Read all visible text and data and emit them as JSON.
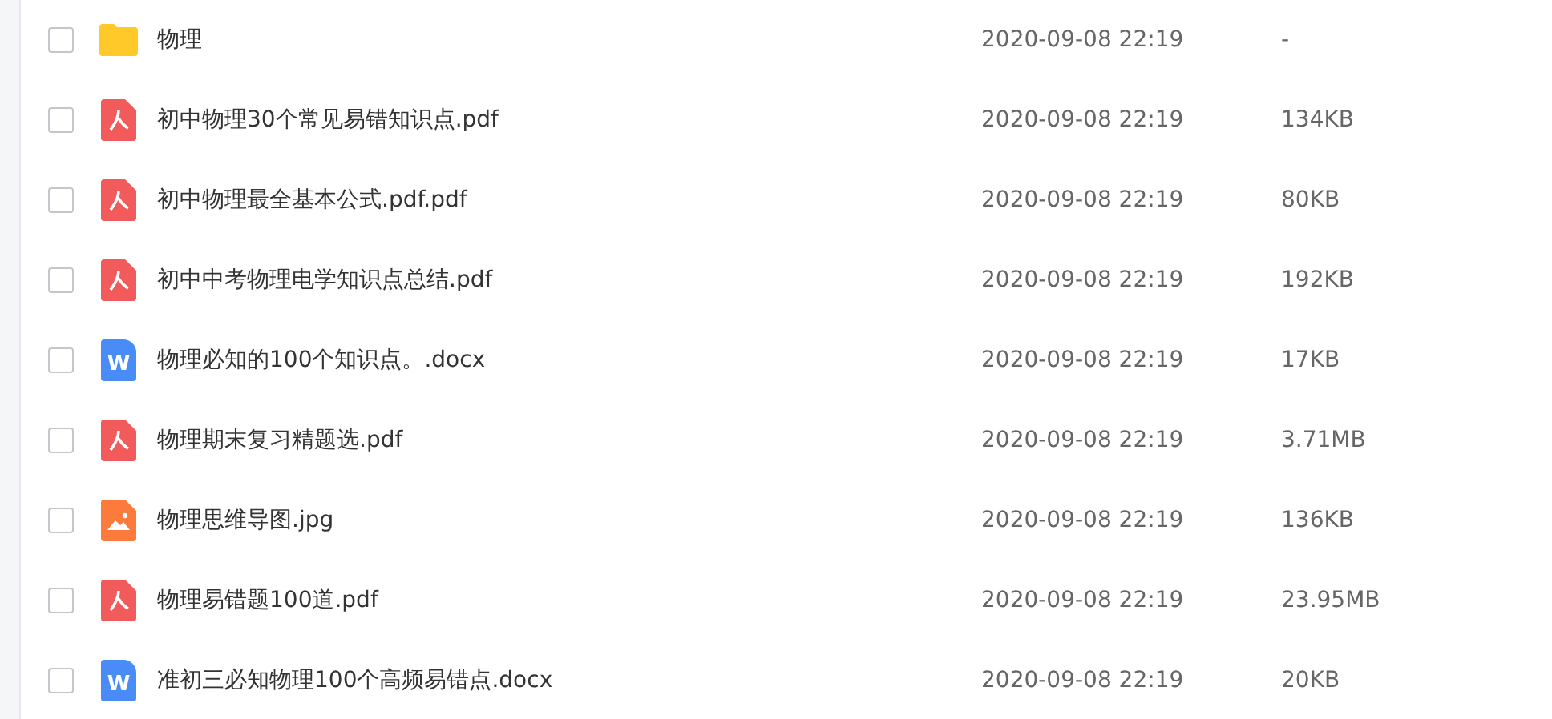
{
  "files": [
    {
      "kind": "folder",
      "name": "物理",
      "date": "2020-09-08 22:19",
      "size": "-",
      "checked": false
    },
    {
      "kind": "pdf",
      "name": "初中物理30个常见易错知识点.pdf",
      "date": "2020-09-08 22:19",
      "size": "134KB",
      "checked": false
    },
    {
      "kind": "pdf",
      "name": "初中物理最全基本公式.pdf.pdf",
      "date": "2020-09-08 22:19",
      "size": "80KB",
      "checked": false
    },
    {
      "kind": "pdf",
      "name": "初中中考物理电学知识点总结.pdf",
      "date": "2020-09-08 22:19",
      "size": "192KB",
      "checked": false
    },
    {
      "kind": "docx",
      "badge": "W",
      "name": "物理必知的100个知识点。.docx",
      "date": "2020-09-08 22:19",
      "size": "17KB",
      "checked": false
    },
    {
      "kind": "pdf",
      "name": "物理期末复习精题选.pdf",
      "date": "2020-09-08 22:19",
      "size": "3.71MB",
      "checked": false
    },
    {
      "kind": "image",
      "name": "物理思维导图.jpg",
      "date": "2020-09-08 22:19",
      "size": "136KB",
      "checked": false
    },
    {
      "kind": "pdf",
      "name": "物理易错题100道.pdf",
      "date": "2020-09-08 22:19",
      "size": "23.95MB",
      "checked": false
    },
    {
      "kind": "docx",
      "badge": "W",
      "name": "准初三必知物理100个高频易错点.docx",
      "date": "2020-09-08 22:19",
      "size": "20KB",
      "checked": false
    }
  ]
}
